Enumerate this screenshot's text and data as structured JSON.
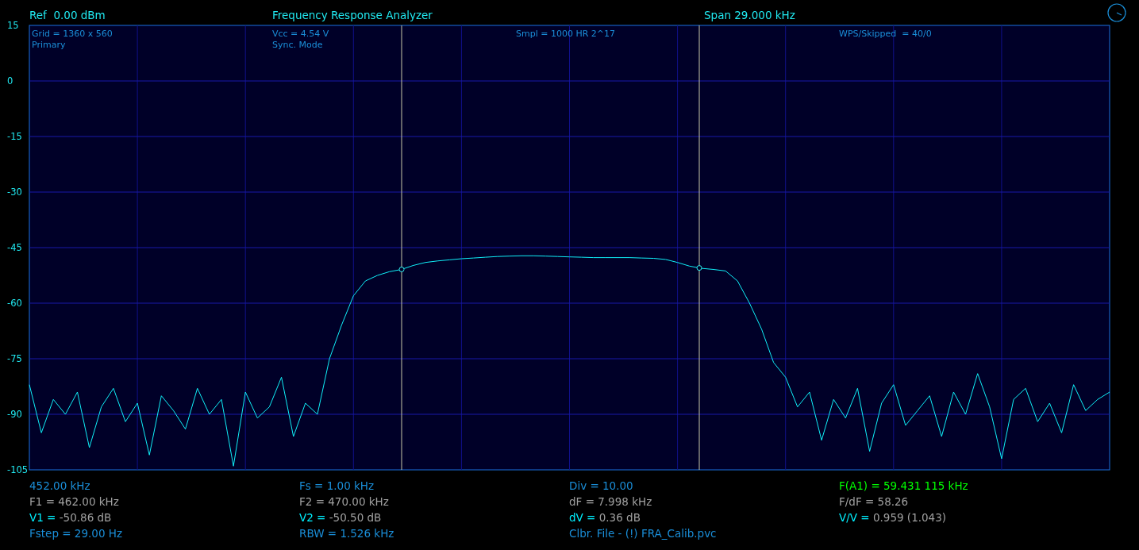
{
  "header": {
    "reference": "Ref  0.00 dBm",
    "title": "Frequency Response Analyzer",
    "span": "Span 29.000 kHz"
  },
  "plot": {
    "chart_data": {
      "type": "line",
      "grid": true,
      "ylim": [
        -105,
        15
      ],
      "yticks": [
        15,
        0,
        -15,
        -30,
        -45,
        -60,
        -75,
        -90,
        -105
      ],
      "series": [
        {
          "color": "#10f0f8",
          "values": [
            -82,
            -95,
            -86,
            -90,
            -84,
            -99,
            -88,
            -83,
            -92,
            -87,
            -101,
            -85,
            -89,
            -94,
            -83,
            -90,
            -86,
            -104,
            -84,
            -91,
            -88,
            -80,
            -96,
            -87,
            -90,
            -75,
            -66,
            -58,
            -54,
            -52.5,
            -51.5,
            -50.9,
            -49.8,
            -49,
            -48.6,
            -48.3,
            -48,
            -47.8,
            -47.6,
            -47.4,
            -47.3,
            -47.2,
            -47.2,
            -47.3,
            -47.4,
            -47.5,
            -47.6,
            -47.7,
            -47.7,
            -47.7,
            -47.7,
            -47.8,
            -47.9,
            -48.2,
            -49,
            -50,
            -50.6,
            -50.9,
            -51.3,
            -54,
            -60,
            -67,
            -76,
            -80,
            -88,
            -84,
            -97,
            -86,
            -91,
            -83,
            -100,
            -87,
            -82,
            -93,
            -89,
            -85,
            -96,
            -84,
            -90,
            -79,
            -88,
            -102,
            -86,
            -83,
            -92,
            -87,
            -95,
            -82,
            -89,
            -86,
            -84
          ]
        }
      ]
    },
    "overlays": [
      {
        "lines": [
          "Grid = 1360 x 560",
          "Primary"
        ]
      },
      {
        "lines": [
          "Vcc = 4.54 V",
          "Sync. Mode"
        ]
      },
      {
        "lines": [
          "Smpl = 1000 HR 2^17"
        ]
      },
      {
        "lines": [
          "WPS/Skipped  = 40/0"
        ]
      }
    ]
  },
  "readouts": [
    [
      {
        "kind": "info",
        "text": "452.00 kHz"
      },
      {
        "kind": "measure",
        "text": "F1 = 462.00 kHz"
      },
      {
        "kind": "voltage",
        "label": "V1 =",
        "text": "-50.86 dB"
      },
      {
        "kind": "info",
        "text": "Fstep = 29.00 Hz"
      }
    ],
    [
      {
        "kind": "info",
        "text": "Fs = 1.00 kHz"
      },
      {
        "kind": "measure",
        "text": "F2 = 470.00 kHz"
      },
      {
        "kind": "voltage",
        "label": "V2 =",
        "text": "-50.50 dB"
      },
      {
        "kind": "info",
        "text": "RBW = 1.526 kHz"
      }
    ],
    [
      {
        "kind": "info",
        "text": "Div = 10.00"
      },
      {
        "kind": "measure",
        "text": "dF = 7.998 kHz"
      },
      {
        "kind": "voltage",
        "label": "dV =",
        "text": "0.36 dB"
      },
      {
        "kind": "info",
        "text": "Clbr. File - (!) FRA_Calib.pvc"
      }
    ],
    [
      {
        "kind": "accent",
        "text": "F(A1) = 59.431 115 kHz"
      },
      {
        "kind": "measure",
        "text": "F/dF = 58.26"
      },
      {
        "kind": "voltage",
        "label": "V/V =",
        "text": "0.959 (1.043)"
      }
    ]
  ]
}
